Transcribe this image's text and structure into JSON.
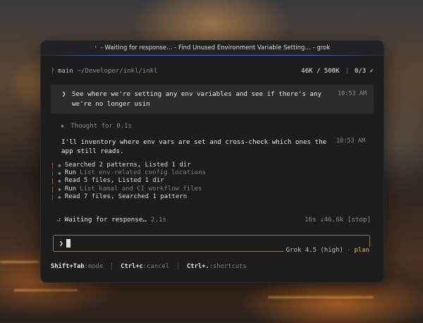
{
  "window": {
    "title": "⠂ - Waiting for response… - Find Unused Environment Variable Setting… - grok"
  },
  "status": {
    "branch_icon": "branch-icon",
    "branch": "main",
    "path": "~/Developer/inkl/inkl",
    "tokens": "46K / 500K",
    "todo": "0/3 ✓"
  },
  "user_message": {
    "caret": "❯",
    "text": "See where we're setting any env variables and see if there's any we're no longer usin",
    "time": "10:53 AM"
  },
  "thought": {
    "label": "Thought",
    "duration": "for 0.1s"
  },
  "assistant": {
    "text": "I'll inventory where env vars are set and cross-check which ones the app still reads.",
    "time": "10:53 AM"
  },
  "tools": [
    {
      "bar": "|",
      "verb": "Searched 2 patterns, Listed 1 dir",
      "detail": ""
    },
    {
      "bar": "|",
      "verb": "Run",
      "detail": "List env-related config locations"
    },
    {
      "bar": "|",
      "verb": "Read 5 files, Listed 1 dir",
      "detail": ""
    },
    {
      "bar": "|",
      "verb": "Run",
      "detail": "List kamal and CI workflow files"
    },
    {
      "bar": "|",
      "verb": "Read 7 files, Searched 1 pattern",
      "detail": ""
    }
  ],
  "waiting": {
    "spinner": "⠴",
    "text": "Waiting for response…",
    "elapsed": "2.1s",
    "stats": "16s ↓46.6k [stop]"
  },
  "input": {
    "caret": "❯",
    "value": ""
  },
  "model": {
    "name": "Grok 4.5 (high)",
    "mode": "plan"
  },
  "footer": {
    "items": [
      {
        "key": "Shift+Tab",
        "desc": ":mode"
      },
      {
        "key": "Ctrl+c",
        "desc": ":cancel"
      },
      {
        "key": "Ctrl+.",
        "desc": ":shortcuts"
      }
    ]
  },
  "colors": {
    "accent": "#e0b347",
    "window_bg": "#1d1d1f",
    "user_bubble": "#2c2c2e",
    "input_border": "#8a7a4a",
    "title_accent": "#3b6fd8"
  }
}
